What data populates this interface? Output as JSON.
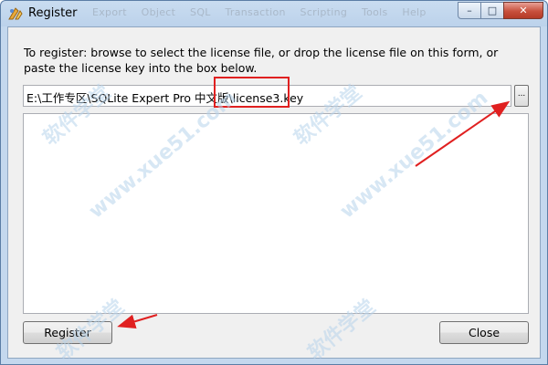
{
  "window": {
    "title": "Register",
    "background_menu": [
      "Export",
      "Object",
      "SQL",
      "Transaction",
      "Scripting",
      "Tools",
      "Help"
    ],
    "controls": {
      "minimize_glyph": "–",
      "maximize_glyph": "□",
      "close_glyph": "✕"
    },
    "app_icon": "sqlite-expert-icon"
  },
  "dialog": {
    "instructions": "To register: browse to select the license file, or drop the license file on this form, or paste the license key into the box below.",
    "license_path_value": "E:\\工作专区\\SQLite Expert Pro  中文版\\license3.key",
    "browse_label": "...",
    "license_key_text": "",
    "register_label": "Register",
    "close_label": "Close"
  },
  "annotations": {
    "highlight_color": "#e02020",
    "arrow_color": "#e02020",
    "highlight_target": "license3.key",
    "arrow_targets": [
      "browse-button",
      "register-button"
    ]
  },
  "watermark": {
    "text": "www.xue51.com",
    "alt_text": "软件学堂",
    "color": "#b8d4ec"
  }
}
